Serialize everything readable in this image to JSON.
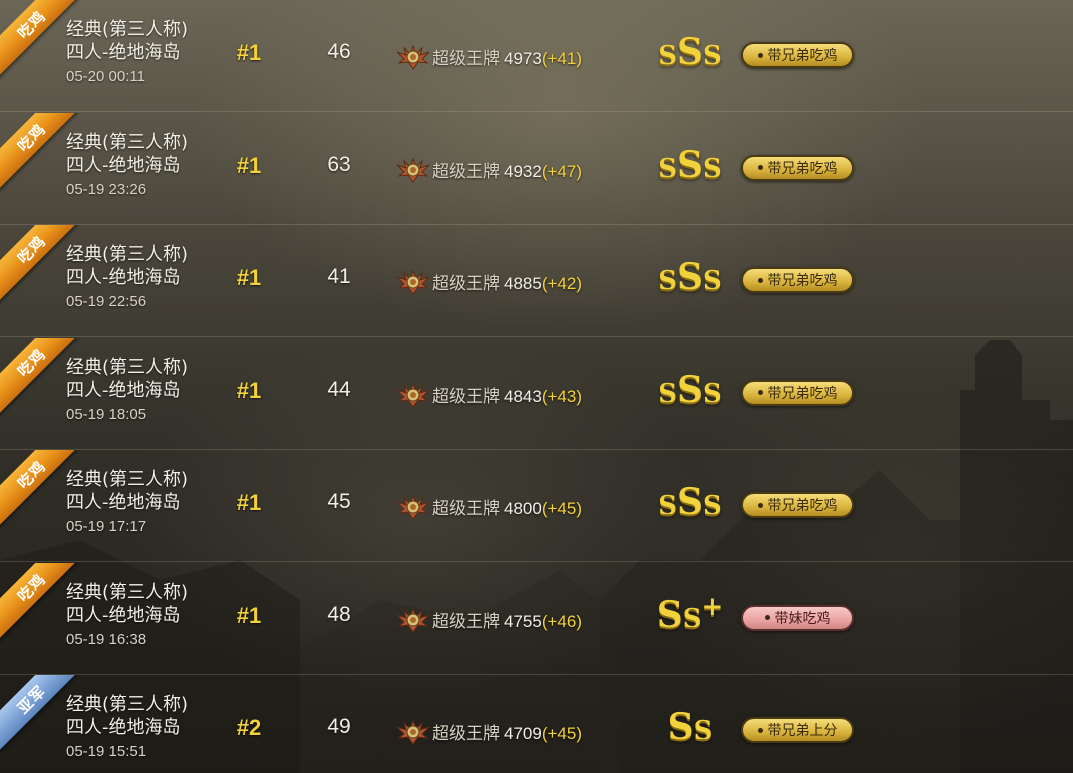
{
  "matches": [
    {
      "result_badge": "吃鸡",
      "badge_type": "chicken",
      "mode_line1": "经典(第三人称)",
      "mode_line2": "四人-绝地海岛",
      "datetime": "05-20 00:11",
      "rank": "#1",
      "kills": "46",
      "tier": "超级王牌",
      "rating": "4973",
      "rating_change": "(+41)",
      "grade": "SSS",
      "tag": "带兄弟吃鸡",
      "tag_style": "gold"
    },
    {
      "result_badge": "吃鸡",
      "badge_type": "chicken",
      "mode_line1": "经典(第三人称)",
      "mode_line2": "四人-绝地海岛",
      "datetime": "05-19 23:26",
      "rank": "#1",
      "kills": "63",
      "tier": "超级王牌",
      "rating": "4932",
      "rating_change": "(+47)",
      "grade": "SSS",
      "tag": "带兄弟吃鸡",
      "tag_style": "gold"
    },
    {
      "result_badge": "吃鸡",
      "badge_type": "chicken",
      "mode_line1": "经典(第三人称)",
      "mode_line2": "四人-绝地海岛",
      "datetime": "05-19 22:56",
      "rank": "#1",
      "kills": "41",
      "tier": "超级王牌",
      "rating": "4885",
      "rating_change": "(+42)",
      "grade": "SSS",
      "tag": "带兄弟吃鸡",
      "tag_style": "gold"
    },
    {
      "result_badge": "吃鸡",
      "badge_type": "chicken",
      "mode_line1": "经典(第三人称)",
      "mode_line2": "四人-绝地海岛",
      "datetime": "05-19 18:05",
      "rank": "#1",
      "kills": "44",
      "tier": "超级王牌",
      "rating": "4843",
      "rating_change": "(+43)",
      "grade": "SSS",
      "tag": "带兄弟吃鸡",
      "tag_style": "gold"
    },
    {
      "result_badge": "吃鸡",
      "badge_type": "chicken",
      "mode_line1": "经典(第三人称)",
      "mode_line2": "四人-绝地海岛",
      "datetime": "05-19 17:17",
      "rank": "#1",
      "kills": "45",
      "tier": "超级王牌",
      "rating": "4800",
      "rating_change": "(+45)",
      "grade": "SSS",
      "tag": "带兄弟吃鸡",
      "tag_style": "gold"
    },
    {
      "result_badge": "吃鸡",
      "badge_type": "chicken",
      "mode_line1": "经典(第三人称)",
      "mode_line2": "四人-绝地海岛",
      "datetime": "05-19 16:38",
      "rank": "#1",
      "kills": "48",
      "tier": "超级王牌",
      "rating": "4755",
      "rating_change": "(+46)",
      "grade": "SS+",
      "tag": "带妹吃鸡",
      "tag_style": "pink"
    },
    {
      "result_badge": "亚军",
      "badge_type": "runnerup",
      "mode_line1": "经典(第三人称)",
      "mode_line2": "四人-绝地海岛",
      "datetime": "05-19 15:51",
      "rank": "#2",
      "kills": "49",
      "tier": "超级王牌",
      "rating": "4709",
      "rating_change": "(+45)",
      "grade": "SS",
      "tag": "带兄弟上分",
      "tag_style": "gold"
    }
  ],
  "colors": {
    "accent_gold": "#f3d13a",
    "chicken_badge": "#e8921a",
    "runnerup_badge": "#7ea4d6",
    "tag_pink": "#e9a3a1"
  },
  "icons": {
    "tier_emblem": "ace-tier-emblem-icon"
  }
}
